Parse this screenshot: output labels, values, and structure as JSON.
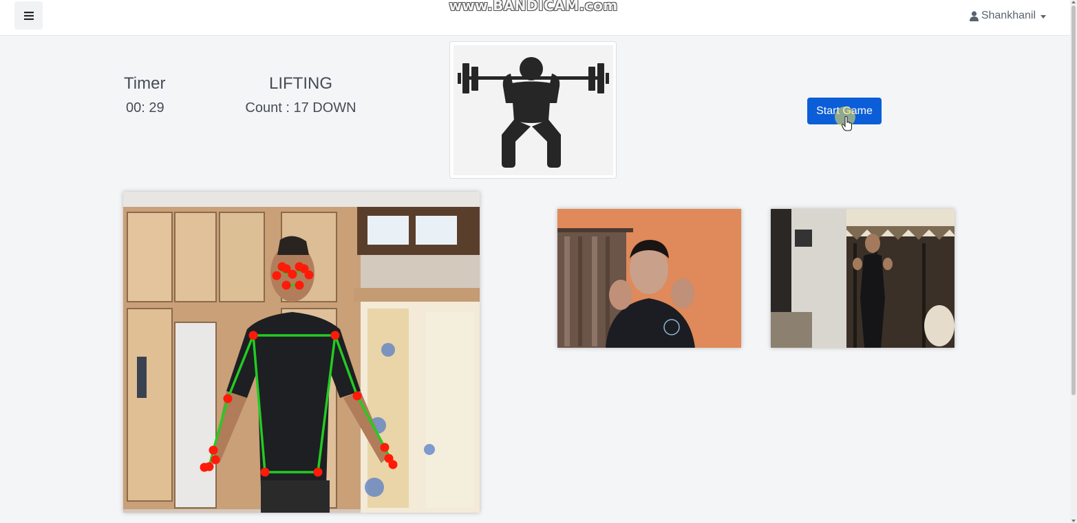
{
  "navbar": {
    "menu_icon": "hamburger-icon",
    "watermark": "www.BANDICAM.com",
    "user_icon": "user-icon",
    "username": "Shankhanil"
  },
  "game": {
    "timer_label": "Timer",
    "timer_value": "00: 29",
    "exercise_name": "LIFTING",
    "count_text": "Count : 17 DOWN",
    "exercise_icon": "weightlifting-squat-icon",
    "start_button_label": "Start Game"
  },
  "videos": {
    "main_feed": "local-camera-with-pose-overlay",
    "participant_1": "remote-participant-orange-room",
    "participant_2": "remote-participant-curtains-room"
  },
  "colors": {
    "primary_button": "#0b5ed7",
    "pose_joint": "#ff1a0a",
    "pose_line": "#22cc22"
  }
}
